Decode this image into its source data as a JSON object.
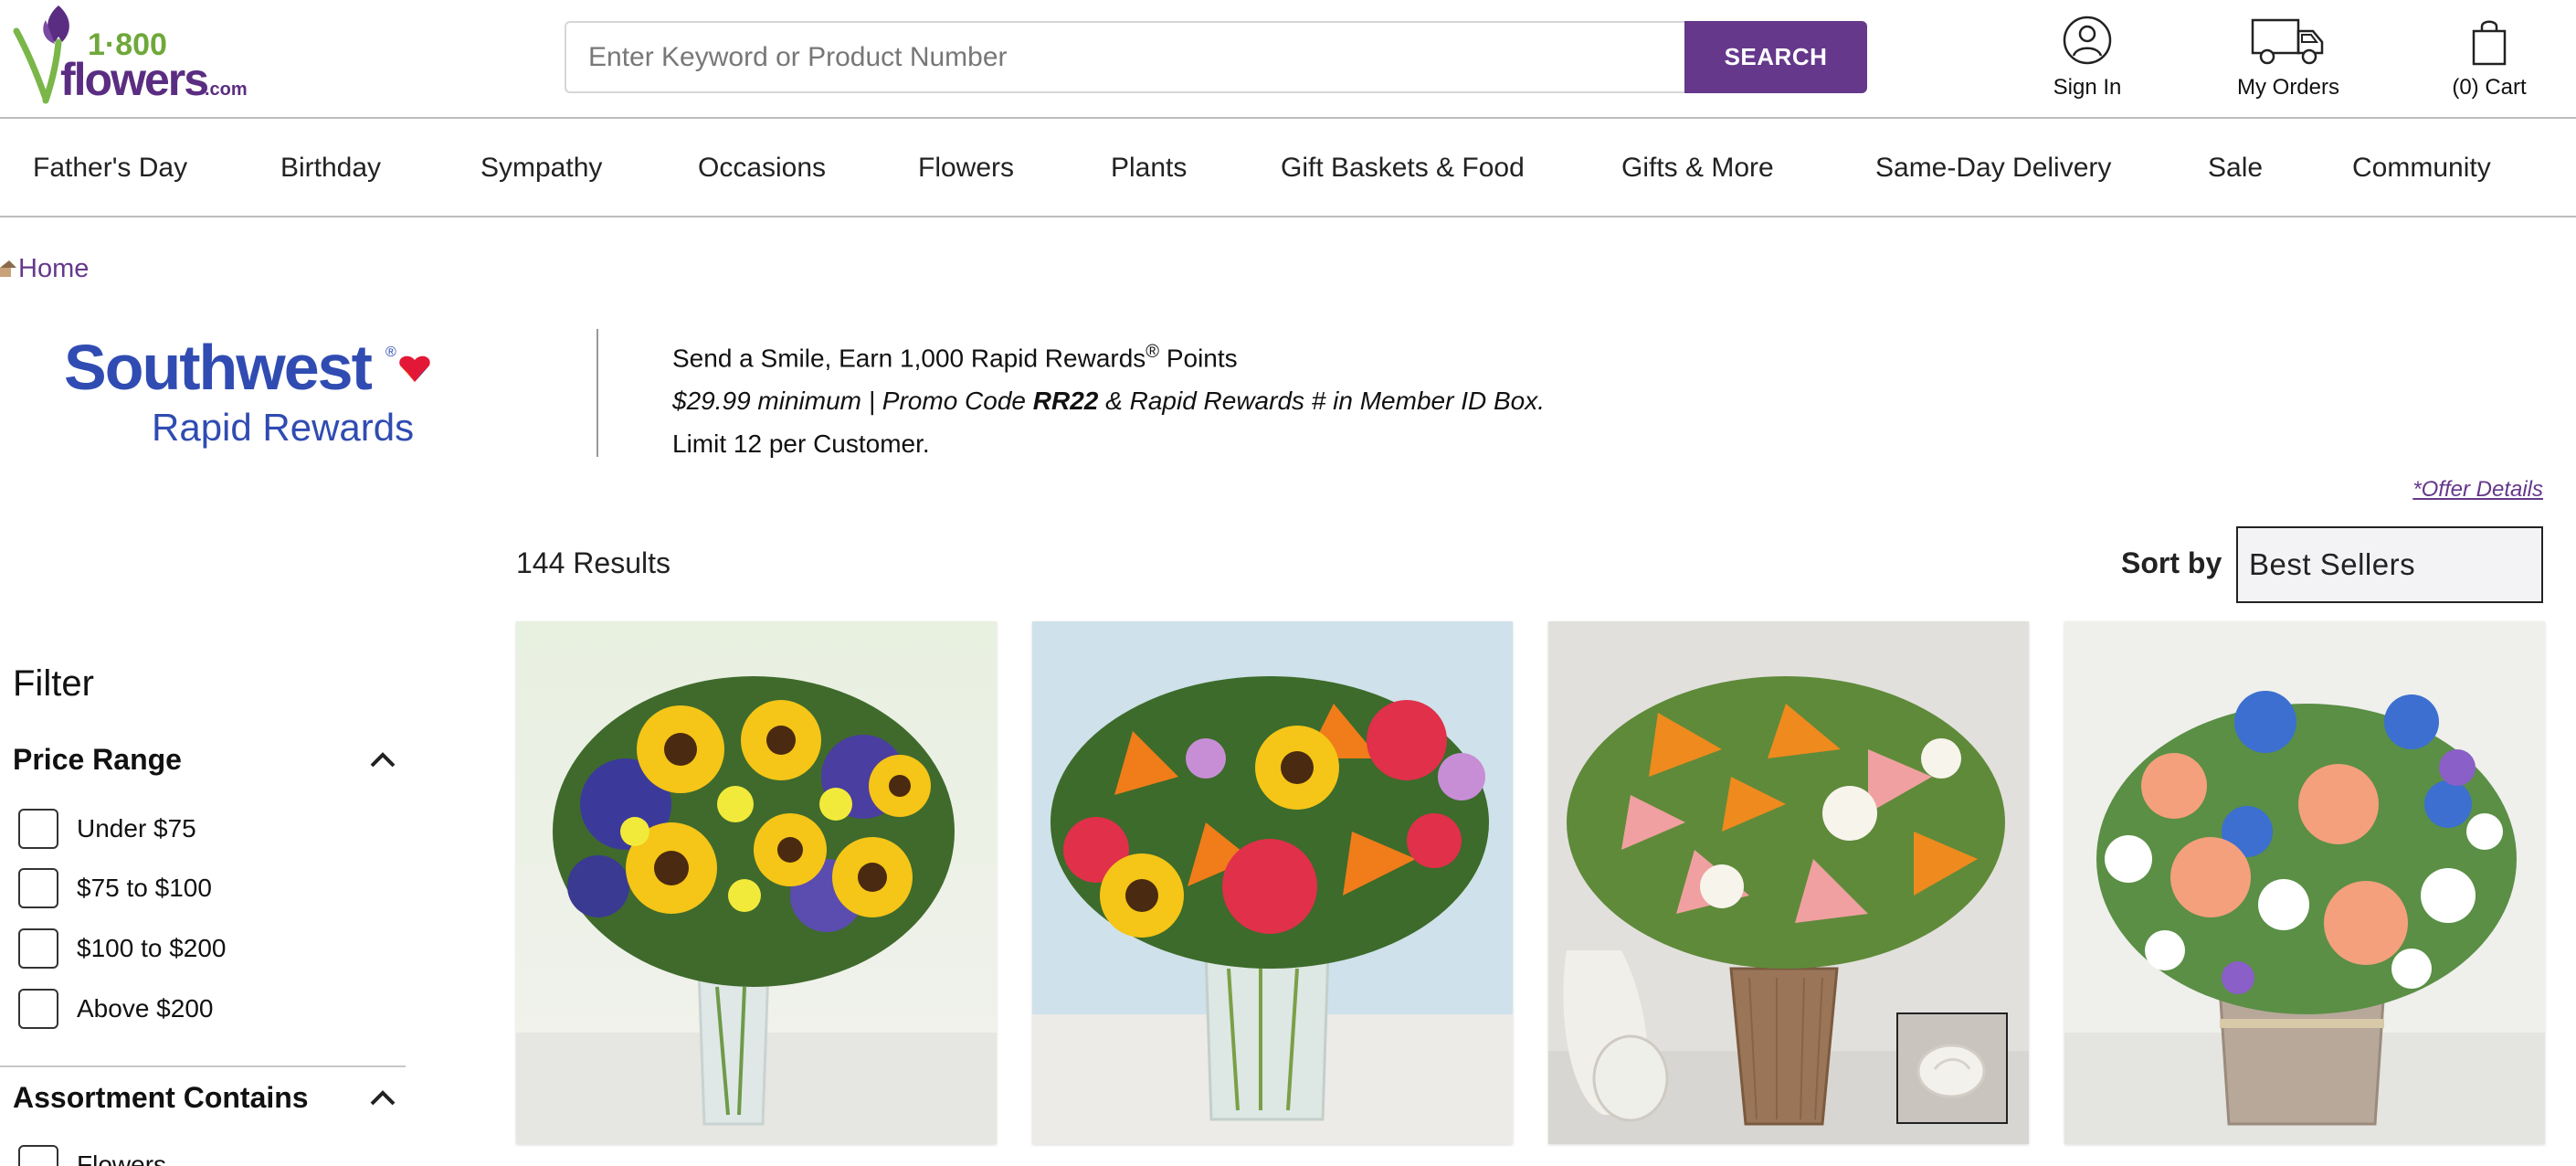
{
  "header": {
    "logo_text": {
      "line1": "1·800",
      "line2": "flowers",
      "suffix": ".com"
    },
    "search": {
      "placeholder": "Enter Keyword or Product Number",
      "button_label": "SEARCH"
    },
    "actions": {
      "sign_in": "Sign In",
      "my_orders": "My Orders",
      "cart": "(0) Cart"
    }
  },
  "nav": {
    "items": [
      "Father's Day",
      "Birthday",
      "Sympathy",
      "Occasions",
      "Flowers",
      "Plants",
      "Gift Baskets & Food",
      "Gifts & More",
      "Same-Day Delivery",
      "Sale",
      "Community"
    ]
  },
  "breadcrumb": {
    "home": "Home"
  },
  "promo": {
    "logo": {
      "brand": "Southwest",
      "sub": "Rapid Rewards",
      "reg": "®"
    },
    "line1": "Send a Smile, Earn 1,000 Rapid Rewards",
    "line1_reg": "®",
    "line1_end": " Points",
    "line2_pre": "$29.99 minimum | Promo Code ",
    "line2_code": "RR22",
    "line2_post": " & Rapid Rewards # in Member ID Box.",
    "line3": "Limit 12 per Customer.",
    "offer_details": "*Offer Details"
  },
  "results": {
    "count": "144 Results",
    "sort_label": "Sort by",
    "sort_value": "Best Sellers"
  },
  "filter": {
    "title": "Filter",
    "price_range": {
      "title": "Price Range",
      "options": [
        "Under $75",
        "$75 to $100",
        "$100 to $200",
        "Above $200"
      ]
    },
    "assortment": {
      "title": "Assortment Contains",
      "options": [
        "Flowers"
      ]
    }
  },
  "colors": {
    "brand_purple": "#65388b",
    "border": "#bdbdbd"
  }
}
